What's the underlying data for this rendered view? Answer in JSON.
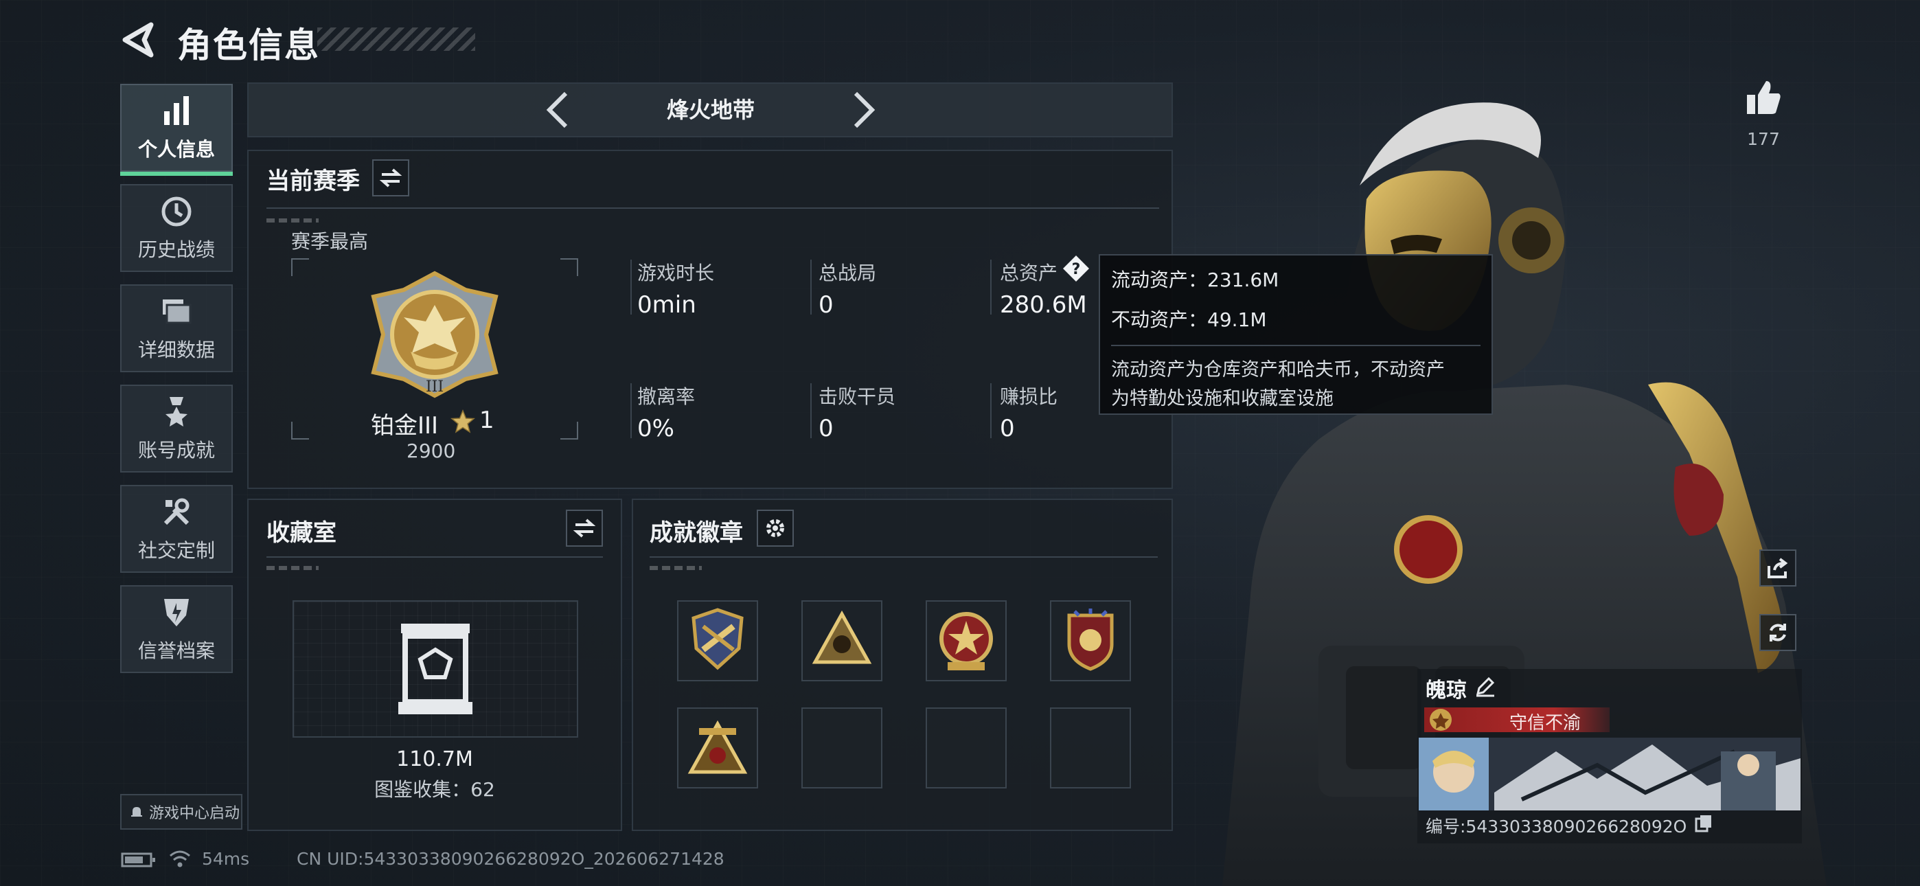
{
  "header": {
    "title": "角色信息"
  },
  "sidebar": {
    "items": [
      {
        "label": "个人信息",
        "icon": "bar-chart-icon",
        "active": true
      },
      {
        "label": "历史战绩",
        "icon": "clock-history-icon"
      },
      {
        "label": "详细数据",
        "icon": "folder-stack-icon"
      },
      {
        "label": "账号成就",
        "icon": "medal-icon"
      },
      {
        "label": "社交定制",
        "icon": "tools-icon"
      },
      {
        "label": "信誉档案",
        "icon": "shield-badge-icon"
      }
    ],
    "launch_label": "游戏中心启动"
  },
  "season": {
    "name": "烽火地带"
  },
  "current_season": {
    "title": "当前赛季",
    "best_label": "赛季最高",
    "rank_name": "铂金III",
    "rank_stars": "1",
    "rank_score": "2900",
    "rank_emblem_numeral": "III",
    "stats": [
      {
        "label": "游戏时长",
        "value": "0min"
      },
      {
        "label": "总战局",
        "value": "0"
      },
      {
        "label": "总资产",
        "value": "280.6M"
      },
      {
        "label": "撤离率",
        "value": "0%"
      },
      {
        "label": "击败干员",
        "value": "0"
      },
      {
        "label": "赚损比",
        "value": "0"
      }
    ]
  },
  "tooltip": {
    "liquid": "流动资产：231.6M",
    "fixed": "不动资产：49.1M",
    "desc_line1": "流动资产为仓库资产和哈夫币，不动资产",
    "desc_line2": "为特勤处设施和收藏室设施"
  },
  "collection": {
    "title": "收藏室",
    "value": "110.7M",
    "count_text": "图鉴收集：62"
  },
  "badges": {
    "title": "成就徽章",
    "filled": [
      "shield-cannon-badge",
      "pyramid-skull-badge",
      "star-medal-badge",
      "wing-shield-badge",
      "triangle-gear-badge"
    ],
    "empty_slots": 3
  },
  "profile": {
    "likes": "177",
    "name": "魄琼",
    "title_tag": "守信不渝",
    "id_text": "编号:5433033809026628092O"
  },
  "footer": {
    "ping": "54ms",
    "uid": "CN UID:5433033809026628092O_202606271428"
  },
  "colors": {
    "accent_green": "#5fd39a",
    "gold": "#c9a24a",
    "title_tag_red": "#8c1f1f"
  }
}
